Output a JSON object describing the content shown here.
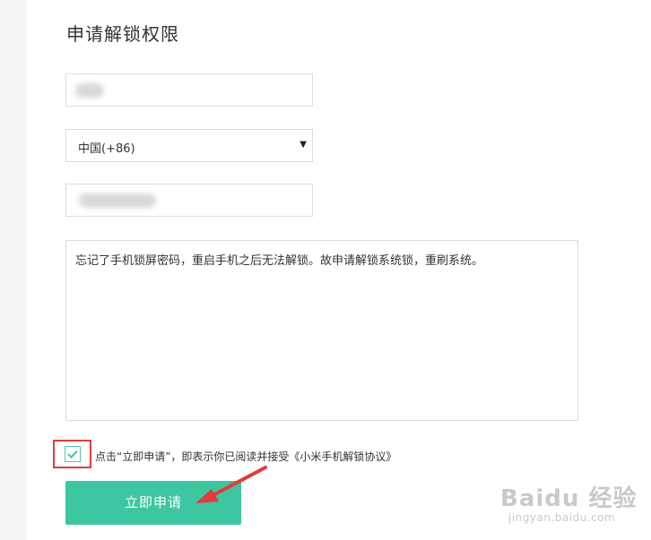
{
  "form": {
    "title": "申请解锁权限",
    "region_value": "中国(+86)",
    "reason_text": "忘记了手机锁屏密码，重启手机之后无法解锁。故申请解锁系统锁，重刷系统。",
    "agree_text": "点击“立即申请”，即表示你已阅读并接受《小米手机解锁协议》",
    "checkbox_checked": true,
    "submit_label": "立即申请"
  },
  "colors": {
    "accent": "#3ec6a0",
    "highlight": "#e03c3c"
  },
  "watermark": {
    "main": "Baidu 经验",
    "sub": "jingyan.baidu.com"
  }
}
